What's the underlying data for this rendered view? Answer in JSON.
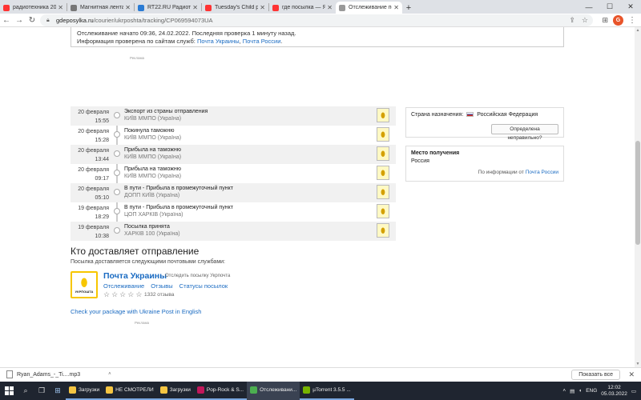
{
  "browser": {
    "tabs": [
      {
        "label": "радиотехника 20-го века — Я...",
        "icon": "yandex-icon",
        "color": "#f33",
        "active": false
      },
      {
        "label": "Магнитная лента - Страница 4",
        "icon": "page-icon",
        "color": "#777",
        "active": false
      },
      {
        "label": "RT22.RU Радиотехника 20 века",
        "icon": "rt-icon",
        "color": "#2a7bd4",
        "active": false
      },
      {
        "label": "Tuesday's Child pic Free the Lig",
        "icon": "yandex-icon",
        "color": "#f33",
        "active": false
      },
      {
        "label": "где посылка — Яндекс: нашлось",
        "icon": "yandex-icon",
        "color": "#f33",
        "active": false
      },
      {
        "label": "Отслеживание посылки Почта",
        "icon": "page-icon",
        "color": "#999",
        "active": true
      }
    ],
    "new_tab": "+",
    "address": {
      "domain": "gdeposylka.ru",
      "path": "/courier/ukrposhta/tracking/CP069594073UA"
    },
    "avatar_letter": "G"
  },
  "info": {
    "line1": "Отслеживание начато 09:36, 24.02.2022. Последняя проверка 1 минуту назад.",
    "line2_prefix": "Информация проверена по сайтам служб: ",
    "link1": "Почта Украины",
    "sep": ", ",
    "link2": "Почта России",
    "end": "."
  },
  "ad_label": "Реклама",
  "events": [
    {
      "date": "20 февраля",
      "time": "15:55",
      "title": "Экспорт из страны отправления",
      "place": "КИЇВ ММПО (Україна)",
      "shade": true
    },
    {
      "date": "20 февраля",
      "time": "15:28",
      "title": "Покинула таможню",
      "place": "КИЇВ ММПО (Україна)",
      "shade": false
    },
    {
      "date": "20 февраля",
      "time": "13:44",
      "title": "Прибыла на таможню",
      "place": "КИЇВ ММПО (Україна)",
      "shade": true
    },
    {
      "date": "20 февраля",
      "time": "09:17",
      "title": "Прибыла на таможню",
      "place": "КИЇВ ММПО (Україна)",
      "shade": false
    },
    {
      "date": "20 февраля",
      "time": "05:10",
      "title": "В пути - Прибыла в промежуточный пункт",
      "place": "ДОПП КИЇВ (Україна)",
      "shade": true
    },
    {
      "date": "19 февраля",
      "time": "18:29",
      "title": "В пути - Прибыла в промежуточный пункт",
      "place": "ЦОП ХАРКІВ (Україна)",
      "shade": false
    },
    {
      "date": "19 февраля",
      "time": "10:38",
      "title": "Посылка принята",
      "place": "ХАРКІВ 100 (Україна)",
      "shade": true
    }
  ],
  "destination": {
    "label": "Страна назначения:",
    "country": "Российская Федерация",
    "wrong_btn": "Определена неправильно?"
  },
  "receipt": {
    "heading": "Место получения",
    "value": "Россия",
    "source_prefix": "По информации от ",
    "source_link": "Почта России"
  },
  "who": {
    "title": "Кто доставляет отправление",
    "subtitle": "Посылка доставляется следующими почтовыми службами:",
    "service_name": "Почта Украины",
    "track_hint": "Отследить посылку Укрпочта",
    "links": [
      "Отслеживание",
      "Отзывы",
      "Статусы посылок"
    ],
    "reviews": "1332 отзыва",
    "logo_text": "УКРПОШТА",
    "english_link": "Check your package with Ukraine Post in English"
  },
  "downloads": {
    "file": "Ryan_Adams_-_Ti....mp3",
    "show_all": "Показать все"
  },
  "taskbar": {
    "apps": [
      {
        "label": "Загрузки",
        "color": "#f5c542",
        "state": "open"
      },
      {
        "label": "НЕ СМОТРЕЛИ",
        "color": "#f5c542",
        "state": "open"
      },
      {
        "label": "Загрузки",
        "color": "#f5c542",
        "state": "open"
      },
      {
        "label": "Pop-Rock & S...",
        "color": "#c2185b",
        "state": "open"
      },
      {
        "label": "Отслеживани...",
        "color": "#4caf50",
        "state": "active"
      },
      {
        "label": "µTorrent 3.5.5 ...",
        "color": "#77b300",
        "state": "open"
      }
    ],
    "lang": "ENG",
    "time": "12:02",
    "date": "05.03.2022"
  }
}
